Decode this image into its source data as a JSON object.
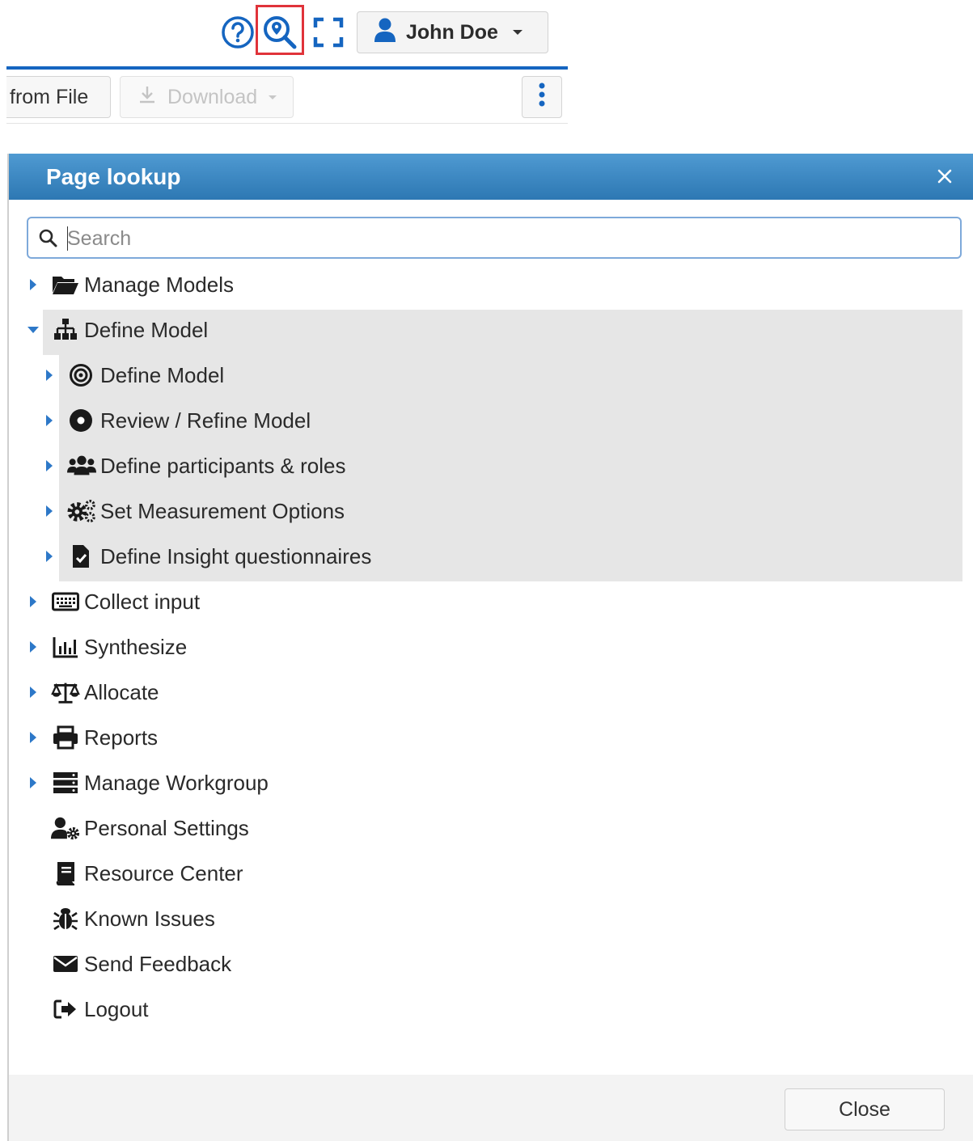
{
  "topbar": {
    "user_name": "John Doe",
    "icons": [
      "question-circle-icon",
      "search-location-icon",
      "fullscreen-icon",
      "user-icon"
    ],
    "accent_color": "#1565c0",
    "highlight_color": "#e0333a"
  },
  "toolbar": {
    "from_file_label": "from File",
    "download_label": "Download"
  },
  "dialog": {
    "title": "Page lookup",
    "search_placeholder": "Search",
    "close_label": "Close",
    "header_color": "#3a87c4",
    "tree": {
      "manage_models": "Manage Models",
      "define_model": "Define Model",
      "define_model_children": [
        "Define Model",
        "Review / Refine Model",
        "Define participants & roles",
        "Set Measurement Options",
        "Define Insight questionnaires"
      ],
      "collect_input": "Collect input",
      "synthesize": "Synthesize",
      "allocate": "Allocate",
      "reports": "Reports",
      "manage_workgroup": "Manage Workgroup",
      "personal_settings": "Personal Settings",
      "resource_center": "Resource Center",
      "known_issues": "Known Issues",
      "send_feedback": "Send Feedback",
      "logout": "Logout"
    }
  }
}
